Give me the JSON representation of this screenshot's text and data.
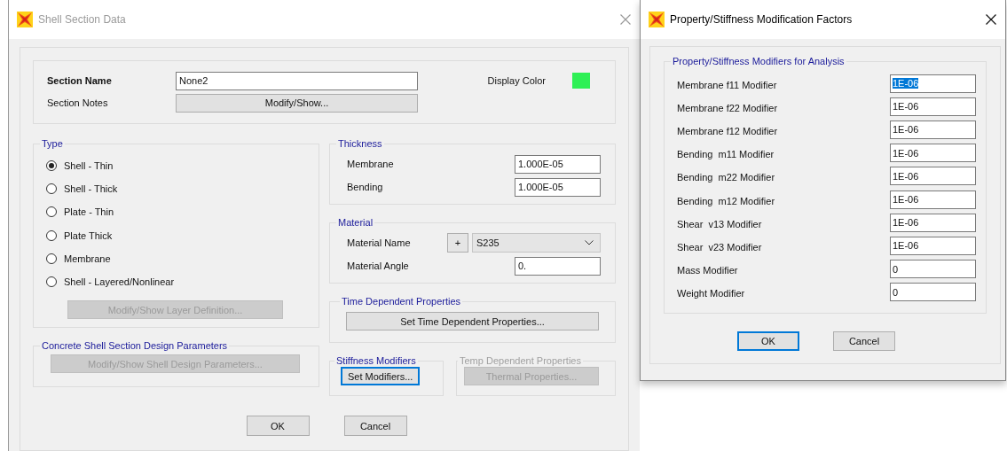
{
  "window": {
    "title": "Shell Section Data",
    "active": false
  },
  "section": {
    "name_label": "Section Name",
    "name_value": "None2",
    "notes_label": "Section Notes",
    "notes_button": "Modify/Show...",
    "color_label": "Display Color"
  },
  "type": {
    "title": "Type",
    "options": [
      {
        "label": "Shell - Thin",
        "selected": true
      },
      {
        "label": "Shell - Thick",
        "selected": false
      },
      {
        "label": "Plate - Thin",
        "selected": false
      },
      {
        "label": "Plate Thick",
        "selected": false
      },
      {
        "label": "Membrane",
        "selected": false
      },
      {
        "label": "Shell - Layered/Nonlinear",
        "selected": false
      }
    ],
    "layer_button": {
      "label": "Modify/Show Layer Definition...",
      "disabled": true
    }
  },
  "thickness": {
    "title": "Thickness",
    "rows": [
      {
        "label": "Membrane",
        "value": "1.000E-05"
      },
      {
        "label": "Bending",
        "value": "1.000E-05"
      }
    ]
  },
  "material": {
    "title": "Material",
    "name_label": "Material Name",
    "add_button": "+",
    "name_value": "S235",
    "angle_label": "Material Angle",
    "angle_value": "0."
  },
  "time_dependent": {
    "title": "Time Dependent Properties",
    "button": {
      "label": "Set Time Dependent Properties...",
      "disabled": false
    }
  },
  "concrete_design": {
    "title": "Concrete Shell Section Design Parameters",
    "disabled": false,
    "button": {
      "label": "Modify/Show Shell Design Parameters...",
      "disabled": true
    }
  },
  "stiffness_modifiers": {
    "title": "Stiffness Modifiers",
    "disabled": false,
    "button": {
      "label": "Set Modifiers...",
      "disabled": false,
      "focused": true
    }
  },
  "temp_dependent": {
    "title": "Temp Dependent Properties",
    "disabled": true,
    "button": {
      "label": "Thermal Properties...",
      "disabled": true
    }
  },
  "buttons": [
    {
      "label": "OK",
      "focused": false
    },
    {
      "label": "Cancel",
      "focused": false
    }
  ],
  "modifiers_dialog": {
    "title": "Property/Stiffness Modification Factors",
    "active": true,
    "group_title": "Property/Stiffness Modifiers for Analysis",
    "rows": [
      {
        "label": "Membrane f11 Modifier",
        "value": "1E-06",
        "text_selected": true
      },
      {
        "label": "Membrane f22 Modifier",
        "value": "1E-06",
        "text_selected": false
      },
      {
        "label": "Membrane f12 Modifier",
        "value": "1E-06",
        "text_selected": false
      },
      {
        "label": "Bending  m11 Modifier",
        "value": "1E-06",
        "text_selected": false
      },
      {
        "label": "Bending  m22 Modifier",
        "value": "1E-06",
        "text_selected": false
      },
      {
        "label": "Bending  m12 Modifier",
        "value": "1E-06",
        "text_selected": false
      },
      {
        "label": "Shear  v13 Modifier",
        "value": "1E-06",
        "text_selected": false
      },
      {
        "label": "Shear  v23 Modifier",
        "value": "1E-06",
        "text_selected": false
      },
      {
        "label": "Mass Modifier",
        "value": "0",
        "text_selected": false
      },
      {
        "label": "Weight Modifier",
        "value": "0",
        "text_selected": false
      }
    ],
    "buttons": [
      {
        "label": "OK",
        "focused": true
      },
      {
        "label": "Cancel",
        "focused": false
      }
    ]
  }
}
